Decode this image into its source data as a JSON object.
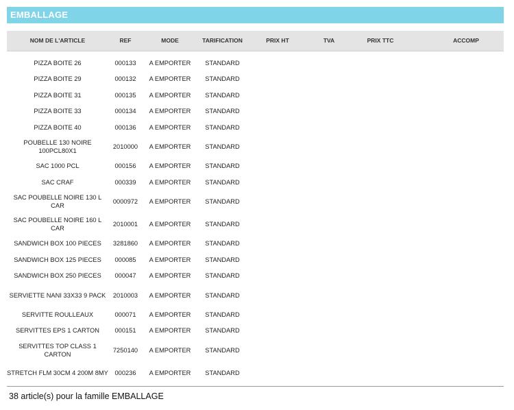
{
  "section_title": "EMBALLAGE",
  "columns": [
    "NOM DE L'ARTICLE",
    "REF",
    "MODE",
    "TARIFICATION",
    "PRIX HT",
    "TVA",
    "PRIX TTC",
    "ACCOMP"
  ],
  "rows": [
    {
      "name": "PIZZA  BOITE  26",
      "ref": "000133",
      "mode": "A EMPORTER",
      "tarif": "STANDARD"
    },
    {
      "name": "PIZZA  BOITE  29",
      "ref": "000132",
      "mode": "A EMPORTER",
      "tarif": "STANDARD"
    },
    {
      "name": "PIZZA  BOITE  31",
      "ref": "000135",
      "mode": "A EMPORTER",
      "tarif": "STANDARD"
    },
    {
      "name": "PIZZA  BOITE  33",
      "ref": "000134",
      "mode": "A EMPORTER",
      "tarif": "STANDARD"
    },
    {
      "name": "PIZZA  BOITE  40",
      "ref": "000136",
      "mode": "A EMPORTER",
      "tarif": "STANDARD"
    },
    {
      "name": "POUBELLE 130 NOIRE 100PCL80X1",
      "ref": "2010000",
      "mode": "A EMPORTER",
      "tarif": "STANDARD"
    },
    {
      "name": "SAC 1000 PCL",
      "ref": "000156",
      "mode": "A EMPORTER",
      "tarif": "STANDARD"
    },
    {
      "name": "SAC CRAF",
      "ref": "000339",
      "mode": "A EMPORTER",
      "tarif": "STANDARD"
    },
    {
      "name": "SAC POUBELLE NOIRE 130 L CAR",
      "ref": "0000972",
      "mode": "A EMPORTER",
      "tarif": "STANDARD"
    },
    {
      "name": "SAC POUBELLE NOIRE 160 L CAR",
      "ref": "2010001",
      "mode": "A EMPORTER",
      "tarif": "STANDARD"
    },
    {
      "name": "SANDWICH BOX 100 PIECES",
      "ref": "3281860",
      "mode": "A EMPORTER",
      "tarif": "STANDARD"
    },
    {
      "name": "SANDWICH BOX 125 PIECES",
      "ref": "000085",
      "mode": "A EMPORTER",
      "tarif": "STANDARD"
    },
    {
      "name": "SANDWICH BOX 250 PIECES",
      "ref": "000047",
      "mode": "A EMPORTER",
      "tarif": "STANDARD"
    },
    {
      "name": "SERVIETTE NANI  33X33 9 PACK",
      "ref": "2010003",
      "mode": "A EMPORTER",
      "tarif": "STANDARD"
    },
    {
      "name": "SERVITTE ROULLEAUX",
      "ref": "000071",
      "mode": "A EMPORTER",
      "tarif": "STANDARD"
    },
    {
      "name": "SERVITTES  EPS 1 CARTON",
      "ref": "000151",
      "mode": "A EMPORTER",
      "tarif": "STANDARD"
    },
    {
      "name": "SERVITTES  TOP CLASS 1 CARTON",
      "ref": "7250140",
      "mode": "A EMPORTER",
      "tarif": "STANDARD"
    },
    {
      "name": "STRETCH FLM 30CM 4 200M 8MY",
      "ref": "000236",
      "mode": "A EMPORTER",
      "tarif": "STANDARD"
    }
  ],
  "footer_text": "38 article(s) pour la famille EMBALLAGE"
}
